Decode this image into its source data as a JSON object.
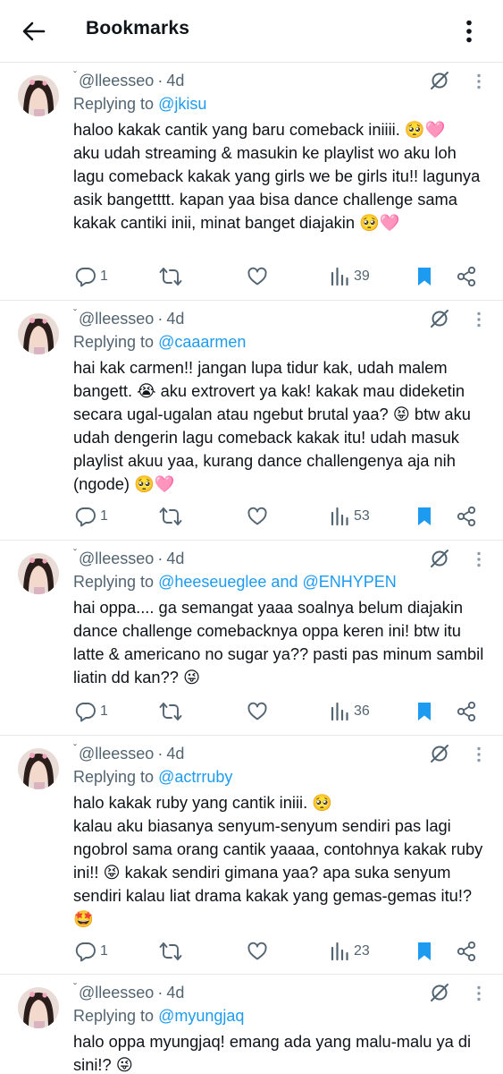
{
  "header": {
    "title": "Bookmarks"
  },
  "icons": {
    "back": "arrow-left-icon",
    "more": "more-vertical-icon",
    "grok": "grok-icon",
    "reply": "reply-icon",
    "retweet": "retweet-icon",
    "like": "heart-icon",
    "views": "views-icon",
    "bookmark": "bookmark-filled-icon",
    "share": "share-icon"
  },
  "colors": {
    "accent": "#1d9bf0",
    "muted": "#536471",
    "text": "#0f1419"
  },
  "tweets": [
    {
      "mark": "ˇ",
      "handle": "@lleesseo",
      "time": "4d",
      "replying_label": "Replying to ",
      "replying_to": "@jkisu",
      "text": "haloo kakak cantik yang baru comeback iniiii. 🥺🩷\naku udah streaming & masukin ke playlist wo aku loh lagu comeback kakak yang girls we be girls itu!! lagunya asik bangetttt. kapan yaa bisa dance challenge sama kakak cantiki inii, minat banget diajakin 🥺🩷",
      "replies": "1",
      "retweets": "",
      "likes": "",
      "views": "39"
    },
    {
      "mark": "ˇ",
      "handle": "@lleesseo",
      "time": "4d",
      "replying_label": "Replying to ",
      "replying_to": "@caaarmen",
      "text": "hai kak carmen!! jangan lupa tidur kak, udah malem bangett. 😭 aku extrovert ya kak! kakak mau dideketin secara ugal-ugalan atau ngebut brutal yaa? 😝 btw aku udah dengerin lagu comeback kakak itu! udah masuk playlist akuu yaa, kurang dance challengenya aja nih (ngode) 🥺🩷",
      "replies": "1",
      "retweets": "",
      "likes": "",
      "views": "53"
    },
    {
      "mark": "ˇ",
      "handle": "@lleesseo",
      "time": "4d",
      "replying_label": "Replying to ",
      "replying_to": "@heeseueglee and @ENHYPEN",
      "text": "hai oppa.... ga semangat yaaa soalnya belum diajakin dance challenge comebacknya oppa keren ini! btw itu latte & americano no sugar ya?? pasti pas minum sambil liatin dd kan?? 😜",
      "replies": "1",
      "retweets": "",
      "likes": "",
      "views": "36"
    },
    {
      "mark": "ˇ",
      "handle": "@lleesseo",
      "time": "4d",
      "replying_label": "Replying to ",
      "replying_to": "@actrruby",
      "text": "halo kakak ruby yang cantik iniii. 🥺\nkalau aku biasanya senyum-senyum sendiri pas lagi ngobrol sama orang cantik yaaaa, contohnya kakak ruby ini!! 😝 kakak sendiri gimana yaa? apa suka senyum sendiri kalau liat drama kakak yang gemas-gemas itu!? 🤩",
      "replies": "1",
      "retweets": "",
      "likes": "",
      "views": "23"
    },
    {
      "mark": "ˇ",
      "handle": "@lleesseo",
      "time": "4d",
      "replying_label": "Replying to ",
      "replying_to": "@myungjaq",
      "text": "halo oppa myungjaq! emang ada yang malu-malu ya di sini!? 😜",
      "replies": "",
      "retweets": "",
      "likes": "",
      "views": ""
    }
  ]
}
